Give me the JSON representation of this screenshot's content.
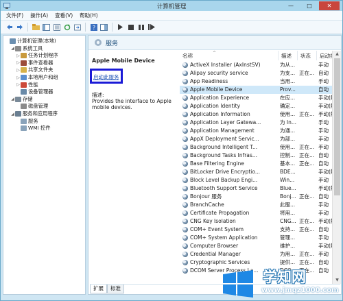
{
  "window": {
    "title": "计算机管理"
  },
  "menu": [
    "文件(F)",
    "操作(A)",
    "查看(V)",
    "帮助(H)"
  ],
  "toolbar": {
    "icons": [
      "back-icon",
      "forward-icon",
      "up-folder-icon",
      "console-tree-icon",
      "properties-icon",
      "refresh-icon",
      "export-icon",
      "help-icon",
      "show-hide-icon",
      "play-icon",
      "stop-icon",
      "pause-icon",
      "restart-icon"
    ]
  },
  "tree": [
    {
      "label": "计算机管理(本地)",
      "level": 0,
      "exp": "",
      "color": "#6b8fb0"
    },
    {
      "label": "系统工具",
      "level": 1,
      "exp": "◢",
      "color": "#8b8b8b"
    },
    {
      "label": "任务计划程序",
      "level": 2,
      "exp": "▷",
      "color": "#c99a3d"
    },
    {
      "label": "事件查看器",
      "level": 2,
      "exp": "▷",
      "color": "#9c4c3a"
    },
    {
      "label": "共享文件夹",
      "level": 2,
      "exp": "▷",
      "color": "#d6b24a"
    },
    {
      "label": "本地用户和组",
      "level": 2,
      "exp": "▷",
      "color": "#5a8fcf"
    },
    {
      "label": "性能",
      "level": 2,
      "exp": "▷",
      "color": "#cc4a3a"
    },
    {
      "label": "设备管理器",
      "level": 2,
      "exp": "",
      "color": "#6a8aa8"
    },
    {
      "label": "存储",
      "level": 1,
      "exp": "◢",
      "color": "#7a8a99"
    },
    {
      "label": "磁盘管理",
      "level": 2,
      "exp": "",
      "color": "#8b8b8b"
    },
    {
      "label": "服务和应用程序",
      "level": 1,
      "exp": "◢",
      "color": "#6a7f92"
    },
    {
      "label": "服务",
      "level": 2,
      "exp": "",
      "color": "#8aa3ba"
    },
    {
      "label": "WMI 控件",
      "level": 2,
      "exp": "",
      "color": "#8aa3ba"
    }
  ],
  "pane": {
    "title": "服务",
    "selected_name": "Apple Mobile Device",
    "start_link": "启动此服务",
    "desc_label": "描述:",
    "desc_text": "Provides the interface to Apple mobile devices.",
    "tabs": [
      "扩展",
      "标准"
    ]
  },
  "columns": {
    "name": "名称",
    "desc": "描述",
    "status": "状态",
    "startup": "启动类型"
  },
  "services": [
    {
      "name": "ActiveX Installer (AxInstSV)",
      "desc": "为从...",
      "status": "",
      "startup": "手动"
    },
    {
      "name": "Alipay security service",
      "desc": "为支...",
      "status": "正在...",
      "startup": "自动"
    },
    {
      "name": "App Readiness",
      "desc": "当用...",
      "status": "",
      "startup": "手动"
    },
    {
      "name": "Apple Mobile Device",
      "desc": "Prov...",
      "status": "",
      "startup": "自动"
    },
    {
      "name": "Application Experience",
      "desc": "在应...",
      "status": "",
      "startup": "手动(触发..."
    },
    {
      "name": "Application Identity",
      "desc": "确定...",
      "status": "",
      "startup": "手动(触发..."
    },
    {
      "name": "Application Information",
      "desc": "使用...",
      "status": "正在...",
      "startup": "手动(触发..."
    },
    {
      "name": "Application Layer Gatewa...",
      "desc": "为 In...",
      "status": "",
      "startup": "手动"
    },
    {
      "name": "Application Management",
      "desc": "为通...",
      "status": "",
      "startup": "手动"
    },
    {
      "name": "AppX Deployment Servic...",
      "desc": "为部...",
      "status": "",
      "startup": "手动"
    },
    {
      "name": "Background Intelligent T...",
      "desc": "使用...",
      "status": "正在...",
      "startup": "手动"
    },
    {
      "name": "Background Tasks Infras...",
      "desc": "控制...",
      "status": "正在...",
      "startup": "自动"
    },
    {
      "name": "Base Filtering Engine",
      "desc": "基本...",
      "status": "正在...",
      "startup": "自动"
    },
    {
      "name": "BitLocker Drive Encryptio...",
      "desc": "BDE...",
      "status": "",
      "startup": "手动(触发..."
    },
    {
      "name": "Block Level Backup Engi...",
      "desc": "Win...",
      "status": "",
      "startup": "手动"
    },
    {
      "name": "Bluetooth Support Service",
      "desc": "Blue...",
      "status": "",
      "startup": "手动(触发..."
    },
    {
      "name": "Bonjour 服务",
      "desc": "Bonj...",
      "status": "正在...",
      "startup": "自动"
    },
    {
      "name": "BranchCache",
      "desc": "此服...",
      "status": "",
      "startup": "手动"
    },
    {
      "name": "Certificate Propagation",
      "desc": "将用...",
      "status": "",
      "startup": "手动"
    },
    {
      "name": "CNG Key Isolation",
      "desc": "CNG...",
      "status": "正在...",
      "startup": "手动(触发..."
    },
    {
      "name": "COM+ Event System",
      "desc": "支持...",
      "status": "正在...",
      "startup": "自动"
    },
    {
      "name": "COM+ System Application",
      "desc": "管理...",
      "status": "",
      "startup": "手动"
    },
    {
      "name": "Computer Browser",
      "desc": "维护...",
      "status": "",
      "startup": "手动(触发..."
    },
    {
      "name": "Credential Manager",
      "desc": "为用...",
      "status": "正在...",
      "startup": "手动"
    },
    {
      "name": "Cryptographic Services",
      "desc": "提供...",
      "status": "正在...",
      "startup": "自动"
    },
    {
      "name": "DCOM Server Process La...",
      "desc": "DCO...",
      "status": "正在...",
      "startup": "自动"
    }
  ],
  "watermark": {
    "brand": "学知网",
    "url": "www.jmqz1000.com"
  }
}
